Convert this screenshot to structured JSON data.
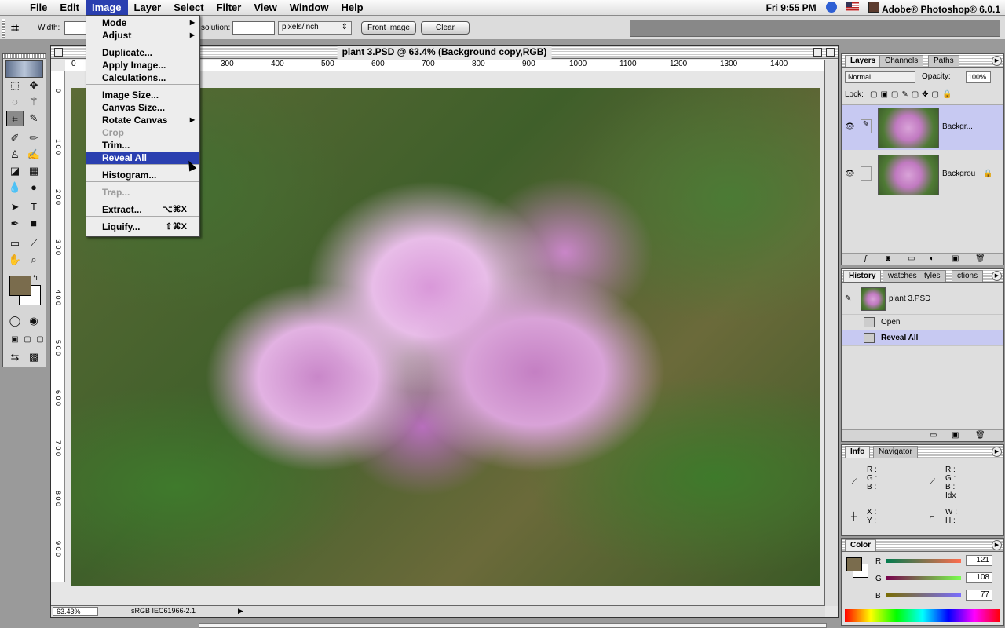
{
  "menubar": {
    "apple": "",
    "items": [
      "File",
      "Edit",
      "Image",
      "Layer",
      "Select",
      "Filter",
      "View",
      "Window",
      "Help"
    ],
    "clock": "Fri 9:55 PM",
    "app_name": "Adobe® Photoshop® 6.0.1"
  },
  "options": {
    "width_label": "Width:",
    "resolution_label": "solution:",
    "resolution_value": "",
    "units": "pixels/inch",
    "front_image": "Front Image",
    "clear": "Clear"
  },
  "image_menu": {
    "mode": "Mode",
    "adjust": "Adjust",
    "duplicate": "Duplicate...",
    "apply_image": "Apply Image...",
    "calculations": "Calculations...",
    "image_size": "Image Size...",
    "canvas_size": "Canvas Size...",
    "rotate_canvas": "Rotate Canvas",
    "crop": "Crop",
    "trim": "Trim...",
    "reveal_all": "Reveal All",
    "histogram": "Histogram...",
    "trap": "Trap...",
    "extract": "Extract...",
    "extract_sc": "⌥⌘X",
    "liquify": "Liquify...",
    "liquify_sc": "⇧⌘X"
  },
  "document": {
    "title": "plant 3.PSD @ 63.4% (Background copy,RGB)",
    "zoom": "63.43%",
    "profile": "sRGB IEC61966-2.1",
    "hruler": [
      "0",
      "300",
      "400",
      "500",
      "600",
      "700",
      "800",
      "900",
      "1000",
      "1100",
      "1200",
      "1300",
      "1400"
    ],
    "vruler": [
      "0",
      "1 0 0",
      "2 0 0",
      "3 0 0",
      "4 0 0",
      "5 0 0",
      "6 0 0",
      "7 0 0",
      "8 0 0",
      "9 0 0"
    ]
  },
  "layers_panel": {
    "tabs": [
      "Layers",
      "Channels",
      "Paths"
    ],
    "blend_mode": "Normal",
    "opacity_label": "Opacity:",
    "opacity_value": "100%",
    "lock_label": "Lock:",
    "layers": [
      {
        "name": "Backgr..."
      },
      {
        "name": "Backgrou"
      }
    ]
  },
  "history_panel": {
    "tabs": [
      "History",
      "watches",
      "tyles",
      "ctions"
    ],
    "snapshot": "plant 3.PSD",
    "steps": [
      "Open",
      "Reveal All"
    ]
  },
  "info_panel": {
    "tabs": [
      "Info",
      "Navigator"
    ],
    "rgb_left": "R :\nG :\nB :",
    "rgb_right": "R :\nG :\nB :\nIdx :",
    "xy": "X :\nY :",
    "wh": "W :\nH :"
  },
  "color_panel": {
    "title": "Color",
    "fg_color": "#7a6c4d",
    "r_label": "R",
    "r": "121",
    "g_label": "G",
    "g": "108",
    "b_label": "B",
    "b": "77"
  }
}
